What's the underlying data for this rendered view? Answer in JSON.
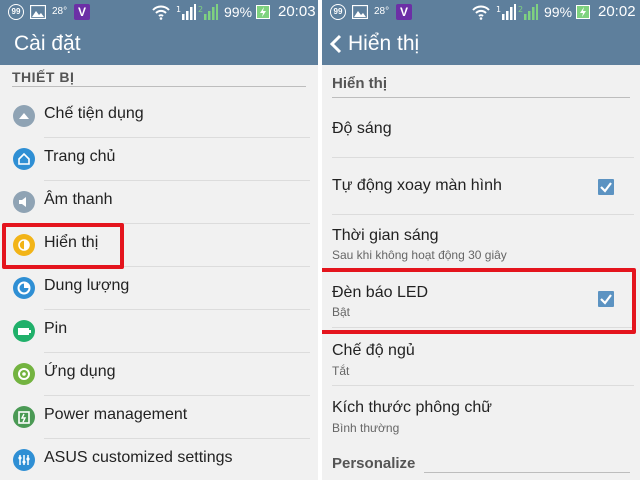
{
  "colors": {
    "bar": "#5e7f9c",
    "highlight": "#e4141d",
    "checkbox": "#5c93c2",
    "background": "#f1f1f1"
  },
  "status_left": {
    "badge": "99",
    "temperature": "28°",
    "carrier_icon": "V",
    "battery": "99%",
    "time": "20:03"
  },
  "status_right": {
    "badge": "99",
    "temperature": "28°",
    "carrier_icon": "V",
    "battery": "99%",
    "time": "20:02"
  },
  "left": {
    "title": "Cài đặt",
    "section": "THIẾT BỊ",
    "items": [
      {
        "label": "Chế tiện dụng",
        "icon": "easy-mode-icon",
        "color": "#8fa3b4"
      },
      {
        "label": "Trang chủ",
        "icon": "home-icon",
        "color": "#2f8fd4"
      },
      {
        "label": "Âm thanh",
        "icon": "sound-icon",
        "color": "#8fa3b4"
      },
      {
        "label": "Hiển thị",
        "icon": "display-icon",
        "color": "#f2b418"
      },
      {
        "label": "Dung lượng",
        "icon": "storage-icon",
        "color": "#2f8fd4"
      },
      {
        "label": "Pin",
        "icon": "battery-icon",
        "color": "#20b06a"
      },
      {
        "label": "Ứng dụng",
        "icon": "apps-icon",
        "color": "#73b340"
      },
      {
        "label": "Power management",
        "icon": "power-management-icon",
        "color": "#4b9a55"
      },
      {
        "label": "ASUS customized settings",
        "icon": "asus-settings-icon",
        "color": "#2f8fd4"
      }
    ]
  },
  "right": {
    "title": "Hiển thị",
    "section": "Hiển thị",
    "items": [
      {
        "label": "Độ sáng",
        "sub": "",
        "checked": false
      },
      {
        "label": "Tự động xoay màn hình",
        "sub": "",
        "checked": true
      },
      {
        "label": "Thời gian sáng",
        "sub": "Sau khi không hoạt động 30 giây",
        "checked": false
      },
      {
        "label": "Đèn báo LED",
        "sub": "Bật",
        "checked": true
      },
      {
        "label": "Chế độ ngủ",
        "sub": "Tắt",
        "checked": false
      },
      {
        "label": "Kích thước phông chữ",
        "sub": "Bình thường",
        "checked": false
      }
    ],
    "section2": "Personalize"
  }
}
